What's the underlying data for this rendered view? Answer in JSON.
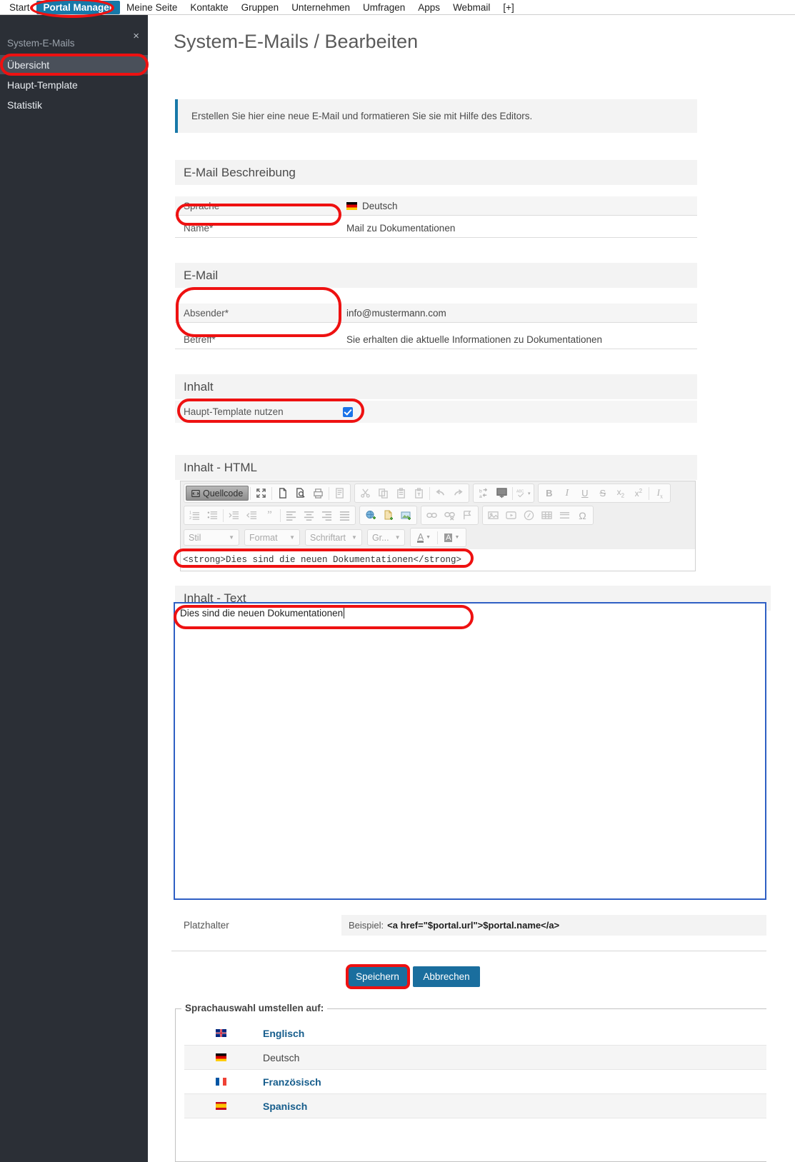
{
  "topnav": {
    "items": [
      {
        "label": "Start",
        "active": false
      },
      {
        "label": "Portal Manager",
        "active": true
      },
      {
        "label": "Meine Seite",
        "active": false
      },
      {
        "label": "Kontakte",
        "active": false
      },
      {
        "label": "Gruppen",
        "active": false
      },
      {
        "label": "Unternehmen",
        "active": false
      },
      {
        "label": "Umfragen",
        "active": false
      },
      {
        "label": "Apps",
        "active": false
      },
      {
        "label": "Webmail",
        "active": false
      },
      {
        "label": "[+]",
        "active": false
      }
    ]
  },
  "sidebar": {
    "close_icon": "×",
    "title": "System-E-Mails",
    "items": [
      {
        "label": "Übersicht",
        "selected": true
      },
      {
        "label": "Haupt-Template",
        "selected": false
      },
      {
        "label": "Statistik",
        "selected": false
      }
    ]
  },
  "page": {
    "title": "System-E-Mails / Bearbeiten",
    "info": "Erstellen Sie hier eine neue E-Mail und formatieren Sie sie mit Hilfe des Editors."
  },
  "sections": {
    "beschreibung": {
      "heading": "E-Mail Beschreibung",
      "sprache_label": "Sprache",
      "sprache_value": "Deutsch",
      "name_label": "Name*",
      "name_value": "Mail zu Dokumentationen"
    },
    "email": {
      "heading": "E-Mail",
      "absender_label": "Absender*",
      "absender_value": "info@mustermann.com",
      "betreff_label": "Betreff*",
      "betreff_value": "Sie erhalten die aktuelle Informationen zu Dokumentationen"
    },
    "inhalt": {
      "heading": "Inhalt",
      "template_label": "Haupt-Template nutzen",
      "template_checked": true
    },
    "inhalt_html": {
      "heading": "Inhalt - HTML"
    },
    "inhalt_text": {
      "heading": "Inhalt - Text"
    }
  },
  "editor": {
    "source_button_label": "Quellcode",
    "row1_icons": [
      "source-icon",
      "maximize-icon",
      "new-page-icon",
      "preview-icon",
      "print-icon",
      "templates-icon",
      "cut-icon",
      "copy-icon",
      "paste-icon",
      "paste-text-icon",
      "undo-icon",
      "redo-icon",
      "find-replace-icon",
      "show-blocks-icon",
      "spellcheck-icon",
      "bold-icon",
      "italic-icon",
      "underline-icon",
      "strikethrough-icon",
      "subscript-icon",
      "superscript-icon",
      "remove-format-icon"
    ],
    "row2_icons": [
      "numbered-list-icon",
      "bulleted-list-icon",
      "outdent-icon",
      "indent-icon",
      "blockquote-icon",
      "align-left-icon",
      "align-center-icon",
      "align-right-icon",
      "justify-icon",
      "internal-link-icon",
      "document-link-icon",
      "image-insert-icon",
      "link-icon",
      "unlink-icon",
      "anchor-icon",
      "image-icon",
      "youtube-icon",
      "flash-icon",
      "table-icon",
      "horizontal-rule-icon",
      "special-char-icon"
    ],
    "dropdowns": [
      {
        "name": "stil-dropdown",
        "label": "Stil"
      },
      {
        "name": "format-dropdown",
        "label": "Format"
      },
      {
        "name": "schriftart-dropdown",
        "label": "Schriftart"
      },
      {
        "name": "groesse-dropdown",
        "label": "Gr..."
      }
    ],
    "color_buttons": [
      "text-color-icon",
      "background-color-icon"
    ],
    "source_value": "<strong>Dies sind die neuen Dokumentationen</strong>"
  },
  "text_content": {
    "value": "Dies sind die neuen Dokumentationen"
  },
  "platzhalter": {
    "label": "Platzhalter",
    "prefix": "Beispiel:",
    "code": "<a href=\"$portal.url\">$portal.name</a>"
  },
  "buttons": {
    "save": "Speichern",
    "cancel": "Abbrechen"
  },
  "language_switch": {
    "legend": "Sprachauswahl umstellen auf:",
    "rows": [
      {
        "flag": "flag-gb",
        "name": "Englisch",
        "current": false
      },
      {
        "flag": "flag-de",
        "name": "Deutsch",
        "current": true
      },
      {
        "flag": "flag-fr",
        "name": "Französisch",
        "current": false
      },
      {
        "flag": "flag-es",
        "name": "Spanisch",
        "current": false
      }
    ]
  },
  "colors": {
    "accent": "#1778a8",
    "sidebar_bg": "#2b2f36",
    "annotation": "#ee1111",
    "focus_border": "#2f5fc4"
  }
}
